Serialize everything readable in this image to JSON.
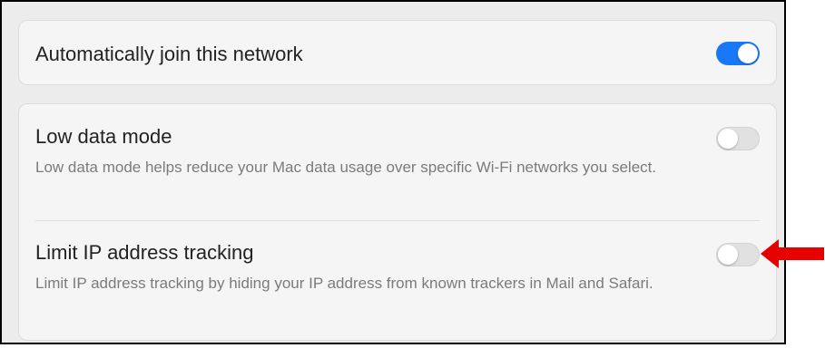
{
  "settings": {
    "auto_join": {
      "label": "Automatically join this network",
      "enabled": true
    },
    "low_data_mode": {
      "label": "Low data mode",
      "description": "Low data mode helps reduce your Mac data usage over specific Wi-Fi networks you select.",
      "enabled": false
    },
    "limit_ip_tracking": {
      "label": "Limit IP address tracking",
      "description": "Limit IP address tracking by hiding your IP address from known trackers in Mail and Safari.",
      "enabled": false
    }
  },
  "colors": {
    "toggle_on": "#1978f5",
    "toggle_off": "#e1e1e1",
    "annotation_arrow": "#e60000"
  },
  "annotation": {
    "icon": "red-arrow-icon"
  }
}
